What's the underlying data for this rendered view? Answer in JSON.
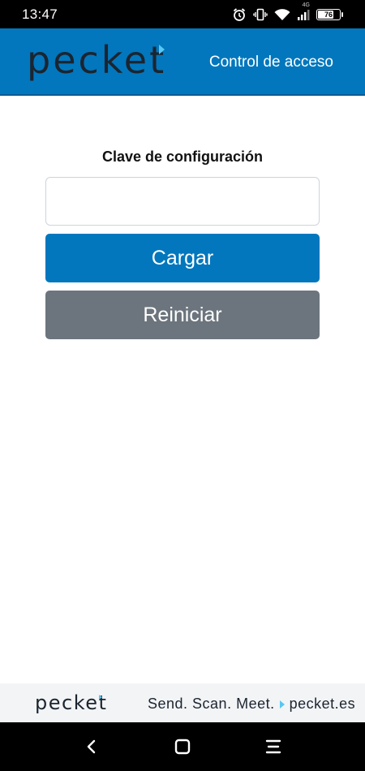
{
  "status_bar": {
    "time": "13:47",
    "network": "4G",
    "battery": "76",
    "battery_level": 0.76,
    "icons": [
      "alarm-icon",
      "vibrate-icon",
      "wifi-icon",
      "signal-icon",
      "battery-icon"
    ]
  },
  "header": {
    "logo": "pecket",
    "title": "Control de acceso",
    "background": "#0277bd"
  },
  "form": {
    "label": "Clave de configuración",
    "input_value": "",
    "input_placeholder": "",
    "load_button": "Cargar",
    "reset_button": "Reiniciar",
    "load_color": "#0277bd",
    "reset_color": "#6c757d"
  },
  "footer": {
    "logo": "pecket",
    "tagline": "Send. Scan. Meet.",
    "website": "pecket.es"
  },
  "nav": {
    "icons": [
      "back-icon",
      "home-icon",
      "menu-icon"
    ]
  }
}
